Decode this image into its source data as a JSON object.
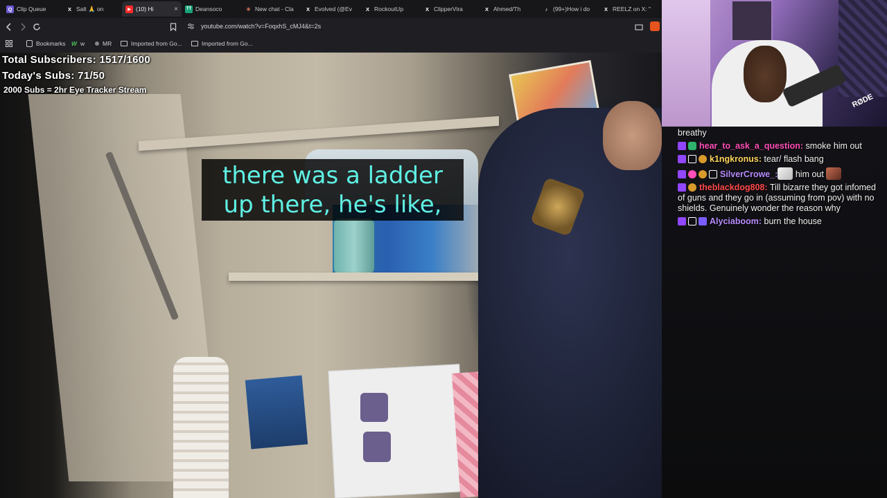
{
  "browser": {
    "tabs": [
      {
        "title": "Clip Queue",
        "fav": "Q",
        "fav_color": "#6b5bd1",
        "active": false
      },
      {
        "title": "Salt 🙏 on",
        "fav": "X",
        "fav_color": "#1f1f23",
        "active": false
      },
      {
        "title": "(10) Hi",
        "fav": "▶",
        "fav_color": "#ff2a2a",
        "active": true
      },
      {
        "title": "Deansoco",
        "fav": "TT",
        "fav_color": "#1aa37a",
        "active": false
      },
      {
        "title": "New chat - Cla",
        "fav": "✳",
        "fav_color": "#d97757",
        "active": false
      },
      {
        "title": "Evolved (@Ev",
        "fav": "X",
        "fav_color": "#1f1f23",
        "active": false
      },
      {
        "title": "RockoutUp",
        "fav": "X",
        "fav_color": "#1f1f23",
        "active": false
      },
      {
        "title": "ClipperVira",
        "fav": "X",
        "fav_color": "#1f1f23",
        "active": false
      },
      {
        "title": "Ahmed/Th",
        "fav": "X",
        "fav_color": "#1f1f23",
        "active": false
      },
      {
        "title": "(99+)How i do",
        "fav": "♪",
        "fav_color": "#1f1f23",
        "active": false
      },
      {
        "title": "REELZ on X: \"",
        "fav": "X",
        "fav_color": "#1f1f23",
        "active": false
      }
    ],
    "close_glyph": "×",
    "url": "youtube.com/watch?v=FoqxhS_cMJ4&t=2s",
    "bookmarks": {
      "label": "Bookmarks",
      "w_label": "w",
      "mr_label": "MR",
      "folder1": "Imported from Go...",
      "folder2": "Imported from Go..."
    }
  },
  "overlay": {
    "total_subs": "Total Subscribers: 1517/1600",
    "today_subs": "Today's Subs: 71/50",
    "goal": "2000 Subs = 2hr Eye Tracker Stream"
  },
  "caption": {
    "line1": "there was a ladder",
    "line2": "up there, he's like,"
  },
  "webcam": {
    "mic_brand": "RØDE"
  },
  "chat": {
    "continuation": "breathy",
    "messages": [
      {
        "user": "hear_to_ask_a_question:",
        "text": " smoke him out"
      },
      {
        "user": "k1ngkronus:",
        "text": " tear/ flash bang"
      },
      {
        "user": "SilverCrowe_:",
        "text": " him out"
      },
      {
        "user": "theblackdog808:",
        "text": " Till bizarre they got infomed of guns and they go in (assuming from pov) with no shields. Genuinely wonder the reason why"
      },
      {
        "user": "Alyciaboom:",
        "text": " burn the house"
      }
    ]
  }
}
